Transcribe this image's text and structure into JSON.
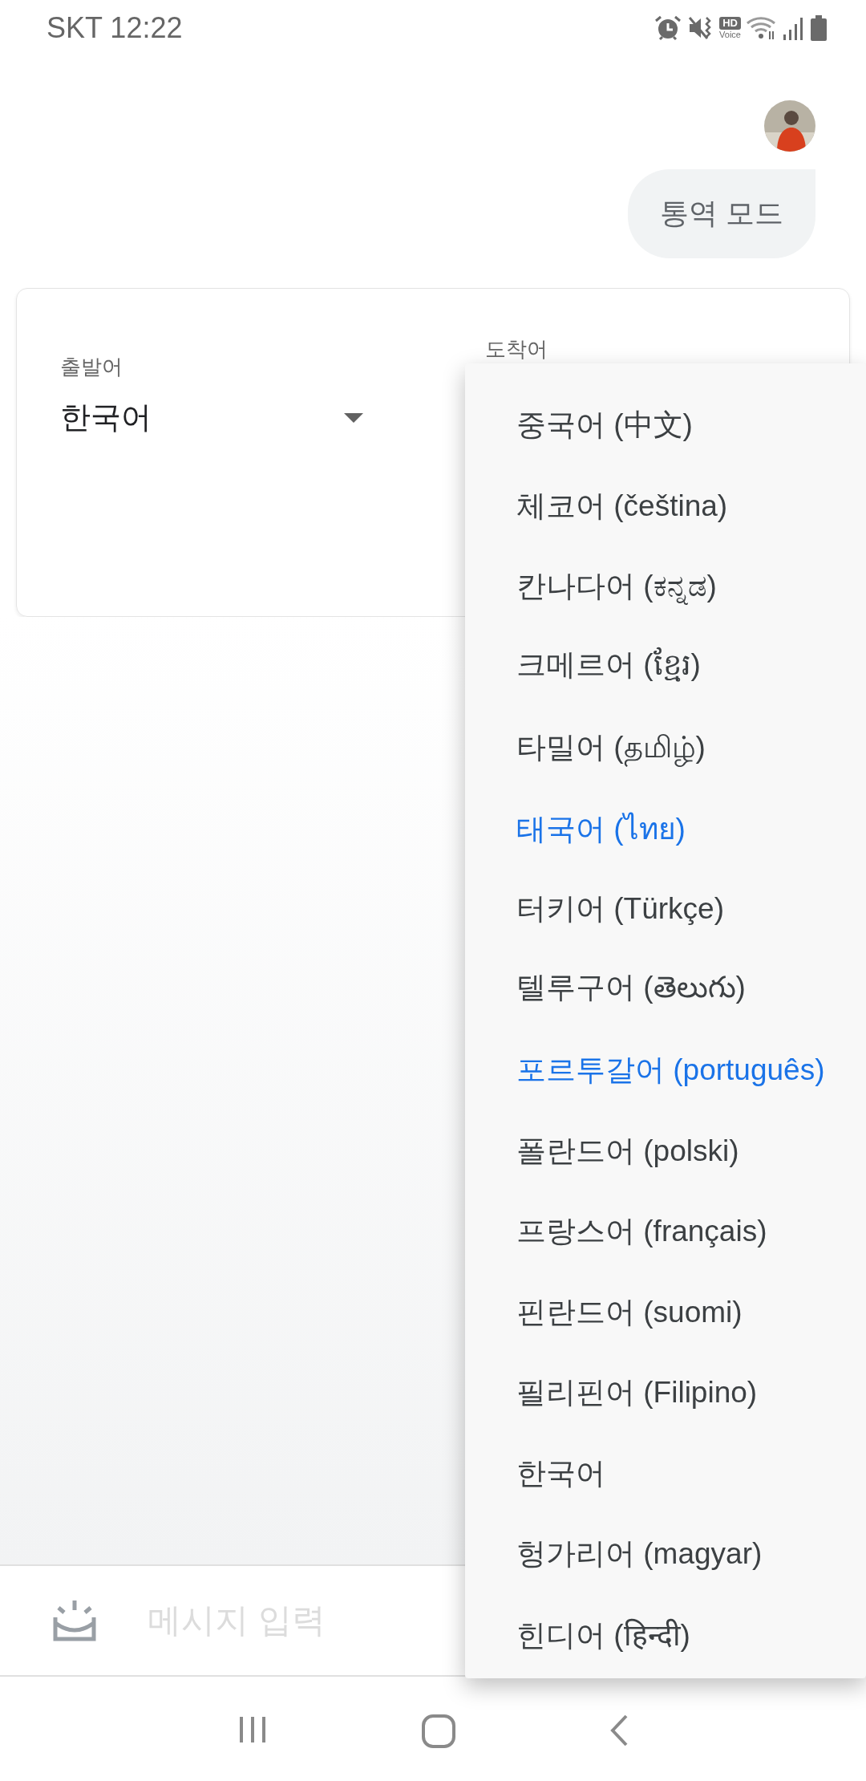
{
  "status_bar": {
    "carrier_time": "SKT 12:22",
    "hd_badge": "HD",
    "hd_caption": "Voice"
  },
  "chat": {
    "message": "통역 모드"
  },
  "language_card": {
    "source_label": "출발어",
    "source_value": "한국어",
    "target_label": "도착어"
  },
  "language_menu": [
    {
      "label": "중국어 (中文)",
      "selected": false
    },
    {
      "label": "체코어 (čeština)",
      "selected": false
    },
    {
      "label": "칸나다어 (ಕನ್ನಡ)",
      "selected": false
    },
    {
      "label": "크메르어 (ខ្មែរ)",
      "selected": false
    },
    {
      "label": "타밀어 (தமிழ்)",
      "selected": false
    },
    {
      "label": "태국어 (ไทย)",
      "selected": true
    },
    {
      "label": "터키어 (Türkçe)",
      "selected": false
    },
    {
      "label": "텔루구어 (తెలుగు)",
      "selected": false
    },
    {
      "label": "포르투갈어 (português)",
      "selected": true
    },
    {
      "label": "폴란드어 (polski)",
      "selected": false
    },
    {
      "label": "프랑스어 (français)",
      "selected": false
    },
    {
      "label": "핀란드어 (suomi)",
      "selected": false
    },
    {
      "label": "필리핀어 (Filipino)",
      "selected": false
    },
    {
      "label": "한국어",
      "selected": false
    },
    {
      "label": "헝가리어 (magyar)",
      "selected": false
    },
    {
      "label": "힌디어 (हिन्दी)",
      "selected": false
    }
  ],
  "input_bar": {
    "placeholder": "메시지 입력"
  }
}
